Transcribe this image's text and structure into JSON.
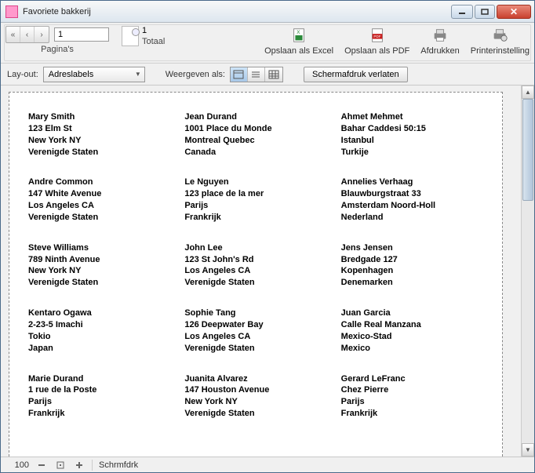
{
  "window": {
    "title": "Favoriete bakkerij"
  },
  "toolbar": {
    "page_input_value": "1",
    "pages_label": "Pagina's",
    "total_count": "1",
    "total_label": "Totaal",
    "save_excel_label": "Opslaan als Excel",
    "save_pdf_label": "Opslaan als PDF",
    "print_label": "Afdrukken",
    "printer_settings_label": "Printerinstelling"
  },
  "toolbar2": {
    "layout_label": "Lay-out:",
    "layout_value": "Adreslabels",
    "show_as_label": "Weergeven als:",
    "exit_preview_label": "Schermafdruk verlaten"
  },
  "status": {
    "zoom": "100",
    "mode": "Schrmfdrk"
  },
  "labels": [
    {
      "line1": "Mary Smith",
      "line2": "123 Elm St",
      "line3": "New York NY",
      "line4": "Verenigde Staten"
    },
    {
      "line1": "Jean Durand",
      "line2": "1001 Place du Monde",
      "line3": "Montreal Quebec",
      "line4": "Canada"
    },
    {
      "line1": "Ahmet Mehmet",
      "line2": "Bahar Caddesi 50:15",
      "line3": "Istanbul",
      "line4": "Turkije"
    },
    {
      "line1": "Andre Common",
      "line2": "147 White Avenue",
      "line3": "Los Angeles CA",
      "line4": "Verenigde Staten"
    },
    {
      "line1": "Le Nguyen",
      "line2": "123 place de la mer",
      "line3": "Parijs",
      "line4": "Frankrijk"
    },
    {
      "line1": "Annelies Verhaag",
      "line2": "Blauwburgstraat 33",
      "line3": "Amsterdam Noord-Holl",
      "line4": "Nederland"
    },
    {
      "line1": "Steve Williams",
      "line2": "789 Ninth Avenue",
      "line3": "New York NY",
      "line4": "Verenigde Staten"
    },
    {
      "line1": "John Lee",
      "line2": "123 St John's Rd",
      "line3": "Los Angeles CA",
      "line4": "Verenigde Staten"
    },
    {
      "line1": "Jens Jensen",
      "line2": "Bredgade 127",
      "line3": "Kopenhagen",
      "line4": "Denemarken"
    },
    {
      "line1": "Kentaro Ogawa",
      "line2": "2-23-5 Imachi",
      "line3": "Tokio",
      "line4": "Japan"
    },
    {
      "line1": "Sophie Tang",
      "line2": "126 Deepwater Bay",
      "line3": "Los Angeles CA",
      "line4": "Verenigde Staten"
    },
    {
      "line1": "Juan Garcia",
      "line2": "Calle Real Manzana",
      "line3": "Mexico-Stad",
      "line4": "Mexico"
    },
    {
      "line1": "Marie Durand",
      "line2": "1 rue de la Poste",
      "line3": "Parijs",
      "line4": "Frankrijk"
    },
    {
      "line1": "Juanita Alvarez",
      "line2": "147 Houston Avenue",
      "line3": "New York NY",
      "line4": "Verenigde Staten"
    },
    {
      "line1": "Gerard LeFranc",
      "line2": "Chez Pierre",
      "line3": "Parijs",
      "line4": "Frankrijk"
    }
  ]
}
